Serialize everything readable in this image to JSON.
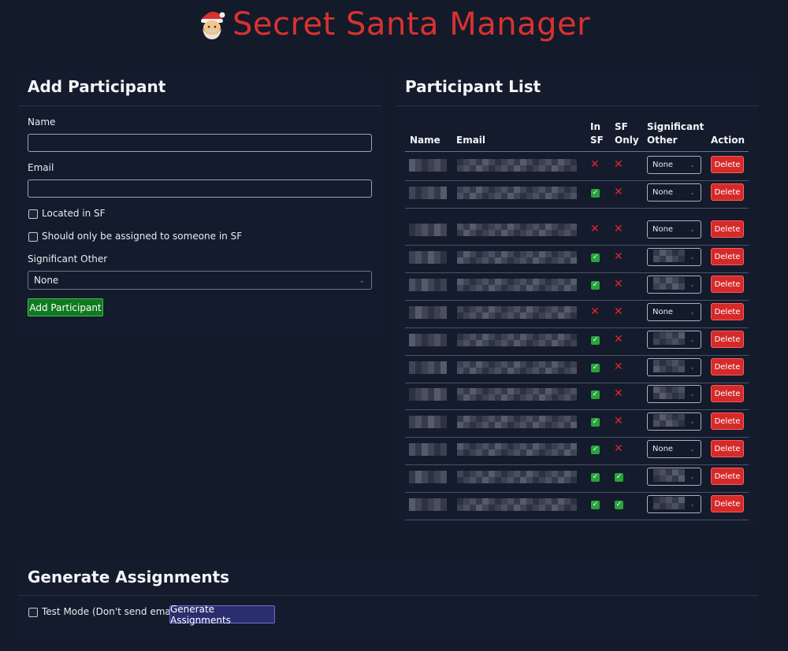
{
  "app": {
    "title": "Secret Santa Manager",
    "emoji": "🎅"
  },
  "add_participant": {
    "heading": "Add Participant",
    "name_label": "Name",
    "name_value": "",
    "email_label": "Email",
    "email_value": "",
    "located_sf_label": "Located in SF",
    "sf_only_label": "Should only be assigned to someone in SF",
    "so_label": "Significant Other",
    "so_selected": "None",
    "submit_label": "Add Participant"
  },
  "participant_list": {
    "heading": "Participant List",
    "columns": {
      "name": "Name",
      "email": "Email",
      "in_sf_1": "In",
      "in_sf_2": "SF",
      "sf_only_1": "SF",
      "sf_only_2": "Only",
      "so_1": "Significant",
      "so_2": "Other",
      "action": "Action"
    },
    "delete_label": "Delete",
    "rows": [
      {
        "in_sf": false,
        "sf_only": false,
        "so": "None"
      },
      {
        "in_sf": true,
        "sf_only": false,
        "so": "None"
      },
      {
        "in_sf": false,
        "sf_only": false,
        "so": "None"
      },
      {
        "in_sf": true,
        "sf_only": false,
        "so": ""
      },
      {
        "in_sf": true,
        "sf_only": false,
        "so": ""
      },
      {
        "in_sf": false,
        "sf_only": false,
        "so": "None"
      },
      {
        "in_sf": true,
        "sf_only": false,
        "so": ""
      },
      {
        "in_sf": true,
        "sf_only": false,
        "so": ""
      },
      {
        "in_sf": true,
        "sf_only": false,
        "so": ""
      },
      {
        "in_sf": true,
        "sf_only": false,
        "so": ""
      },
      {
        "in_sf": true,
        "sf_only": false,
        "so": "None"
      },
      {
        "in_sf": true,
        "sf_only": true,
        "so": ""
      },
      {
        "in_sf": true,
        "sf_only": true,
        "so": ""
      }
    ]
  },
  "generate": {
    "heading": "Generate Assignments",
    "test_mode_label": "Test Mode (Don't send emails)",
    "button_label": "Generate Assignments"
  },
  "colors": {
    "background": "#131a2a",
    "title_red": "#d9322f",
    "delete_red": "#d42a2a",
    "add_green": "#117a21",
    "generate_purple": "#2a2e6e"
  },
  "icons": {
    "title": "santa-emoji",
    "yes": "green-check-icon",
    "no": "red-x-icon",
    "select": "chevron-down-icon"
  }
}
